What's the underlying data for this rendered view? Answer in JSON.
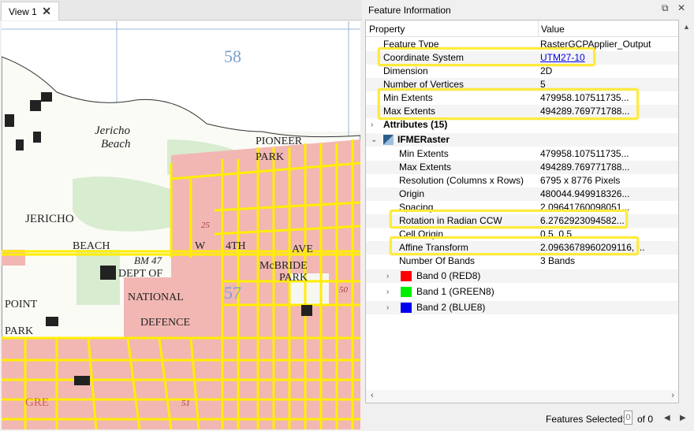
{
  "view": {
    "tab_label": "View 1",
    "close_glyph": "✕",
    "map": {
      "labels": {
        "grid_58": "58",
        "grid_57": "57",
        "jericho_beach_line1": "Jericho",
        "jericho_beach_line2": "Beach",
        "pioneer": "PIONEER",
        "park_top": "PARK",
        "jericho": "JERICHO",
        "beach": "BEACH",
        "bm": "BM 47",
        "dept_of": "DEPT OF",
        "national": "NATIONAL",
        "defence": "DEFENCE",
        "point": "POINT",
        "park_left": "PARK",
        "w": "W",
        "fourth": "4TH",
        "ave": "AVE",
        "mcbride": "McBRIDE",
        "park_right": "PARK",
        "num_25": "25",
        "num_50": "50",
        "num_51": "51",
        "gre": "GRE"
      }
    }
  },
  "info": {
    "title": "Feature Information",
    "controls": {
      "float": "⧉",
      "close": "✕"
    },
    "columns": {
      "property": "Property",
      "value": "Value"
    },
    "rows": [
      {
        "property": "Feature Type",
        "value": "RasterGCPApplier_Output"
      },
      {
        "property": "Coordinate System",
        "value": "UTM27-10"
      },
      {
        "property": "Dimension",
        "value": "2D"
      },
      {
        "property": "Number of Vertices",
        "value": "5"
      },
      {
        "property": "Min Extents",
        "value": "479958.107511735..."
      },
      {
        "property": "Max Extents",
        "value": "494289.769771788..."
      },
      {
        "property": "Attributes (15)",
        "value": ""
      },
      {
        "property": "IFMERaster",
        "value": ""
      },
      {
        "property": "Min Extents",
        "value": "479958.107511735..."
      },
      {
        "property": "Max Extents",
        "value": "494289.769771788..."
      },
      {
        "property": "Resolution (Columns x Rows)",
        "value": "6795 x 8776 Pixels"
      },
      {
        "property": "Origin",
        "value": "480044.949918326..."
      },
      {
        "property": "Spacing",
        "value": "2.09641760098051..."
      },
      {
        "property": "Rotation in Radian CCW",
        "value": "6.2762923094582..."
      },
      {
        "property": "Cell Origin",
        "value": "0.5, 0.5"
      },
      {
        "property": "Affine Transform",
        "value": "2.0963678960209116, ..."
      },
      {
        "property": "Number Of Bands",
        "value": "3 Bands"
      },
      {
        "property": "Band 0 (RED8)",
        "value": ""
      },
      {
        "property": "Band 1 (GREEN8)",
        "value": ""
      },
      {
        "property": "Band 2 (BLUE8)",
        "value": ""
      }
    ],
    "band_colors": [
      "#ff0000",
      "#00ee00",
      "#0000ee"
    ],
    "status": {
      "label": "Features Selected:",
      "selected": "0",
      "of": "of 0"
    },
    "highlight_color": "#ffeb3b"
  }
}
